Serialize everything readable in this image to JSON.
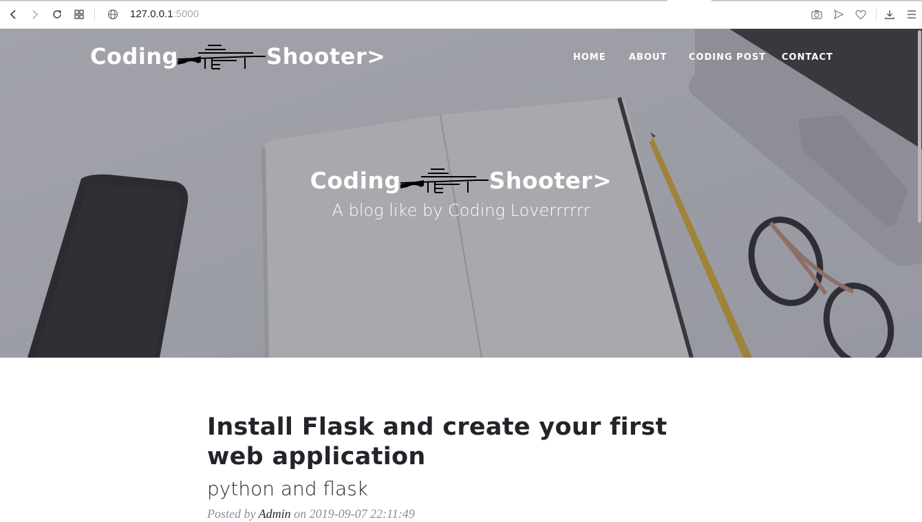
{
  "browser": {
    "url_host": "127.0.0.1",
    "url_port": ":5000",
    "icons": [
      "back-icon",
      "forward-icon",
      "reload-icon",
      "tabs-grid-icon",
      "globe-icon",
      "camera-icon",
      "send-icon",
      "heart-icon",
      "download-icon",
      "menu-icon"
    ]
  },
  "site": {
    "brand_left": "Coding",
    "brand_right": "Shooter>",
    "nav": [
      "HOME",
      "ABOUT",
      "CODING POST",
      "CONTACT"
    ]
  },
  "hero": {
    "title_left": "Coding",
    "title_right": "Shooter>",
    "subtitle": "A blog like by Coding Loverrrrrr"
  },
  "post": {
    "title": "Install Flask and create your first web application",
    "subtitle": "python and flask",
    "meta_prefix": "Posted by ",
    "author": "Admin",
    "meta_on": " on ",
    "date": "2019-09-07 22:11:49"
  },
  "colors": {
    "text_dark": "#212529",
    "meta_gray": "#868e96",
    "hero_overlay": "#464852"
  }
}
